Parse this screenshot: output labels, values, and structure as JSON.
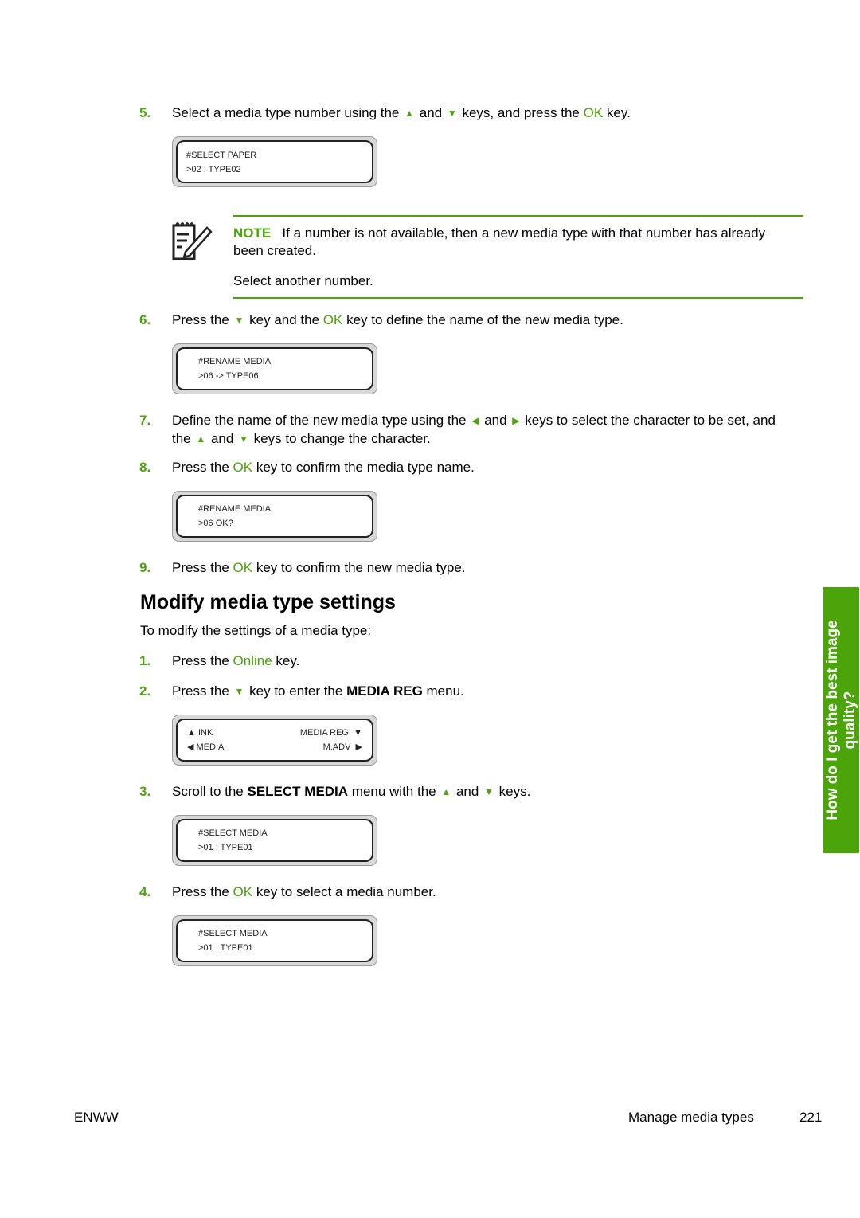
{
  "steps_top": [
    {
      "num": "5.",
      "parts": [
        "Select a media type number using the ",
        " and ",
        " keys, and press the ",
        "OK",
        " key."
      ]
    },
    {
      "num": "6.",
      "parts": [
        "Press the ",
        " key and the ",
        "OK",
        " key to define the name of the new media type."
      ]
    },
    {
      "num": "7.",
      "line1": [
        "Define the name of the new media type using the ",
        " and ",
        " keys to select the character to be set, and"
      ],
      "line2": [
        "the ",
        " and ",
        " keys to change the character."
      ]
    },
    {
      "num": "8.",
      "parts": [
        "Press the ",
        "OK",
        " key to confirm the media type name."
      ]
    },
    {
      "num": "9.",
      "parts": [
        "Press the ",
        "OK",
        " key to confirm the new media type."
      ]
    }
  ],
  "lcd": {
    "select_paper": {
      "line1": "#SELECT PAPER",
      "line2": ">02 : TYPE02"
    },
    "rename1": {
      "line1": "#RENAME MEDIA",
      "line2": ">06 -> TYPE06"
    },
    "rename2": {
      "line1": "#RENAME MEDIA",
      "line2": ">06 OK?"
    },
    "menu": {
      "top_left": "INK",
      "top_right": "MEDIA REG",
      "bottom_left": "MEDIA",
      "bottom_right": "M.ADV"
    },
    "select_media1": {
      "line1": "#SELECT MEDIA",
      "line2": ">01 : TYPE01"
    },
    "select_media2": {
      "line1": "#SELECT MEDIA",
      "line2": ">01 : TYPE01"
    }
  },
  "note": {
    "label": "NOTE",
    "text_line1": "If a number is not available, then a new media type with that number has already",
    "text_line2": "been created.",
    "text2": "Select another number.",
    "icon": "note-pencil-icon"
  },
  "section": {
    "title": "Modify media type settings",
    "intro": "To modify the settings of a media type:",
    "steps": [
      {
        "num": "1.",
        "parts": [
          "Press the ",
          "Online",
          " key."
        ]
      },
      {
        "num": "2.",
        "parts": [
          "Press the ",
          " key to enter the ",
          "MEDIA REG",
          " menu."
        ]
      },
      {
        "num": "3.",
        "parts": [
          "Scroll to the ",
          "SELECT MEDIA",
          " menu with the ",
          " and ",
          " keys."
        ]
      },
      {
        "num": "4.",
        "parts": [
          "Press the ",
          "OK",
          " key to select a media number."
        ]
      }
    ]
  },
  "side_tab": {
    "line1": "How do I get the best image",
    "line2": "quality?"
  },
  "footer": {
    "left": "ENWW",
    "section": "Manage media types",
    "page": "221"
  },
  "glyphs": {
    "up": "▲",
    "down": "▼",
    "left": "◀",
    "right": "▶"
  },
  "colors": {
    "accent": "#4aa40a"
  }
}
